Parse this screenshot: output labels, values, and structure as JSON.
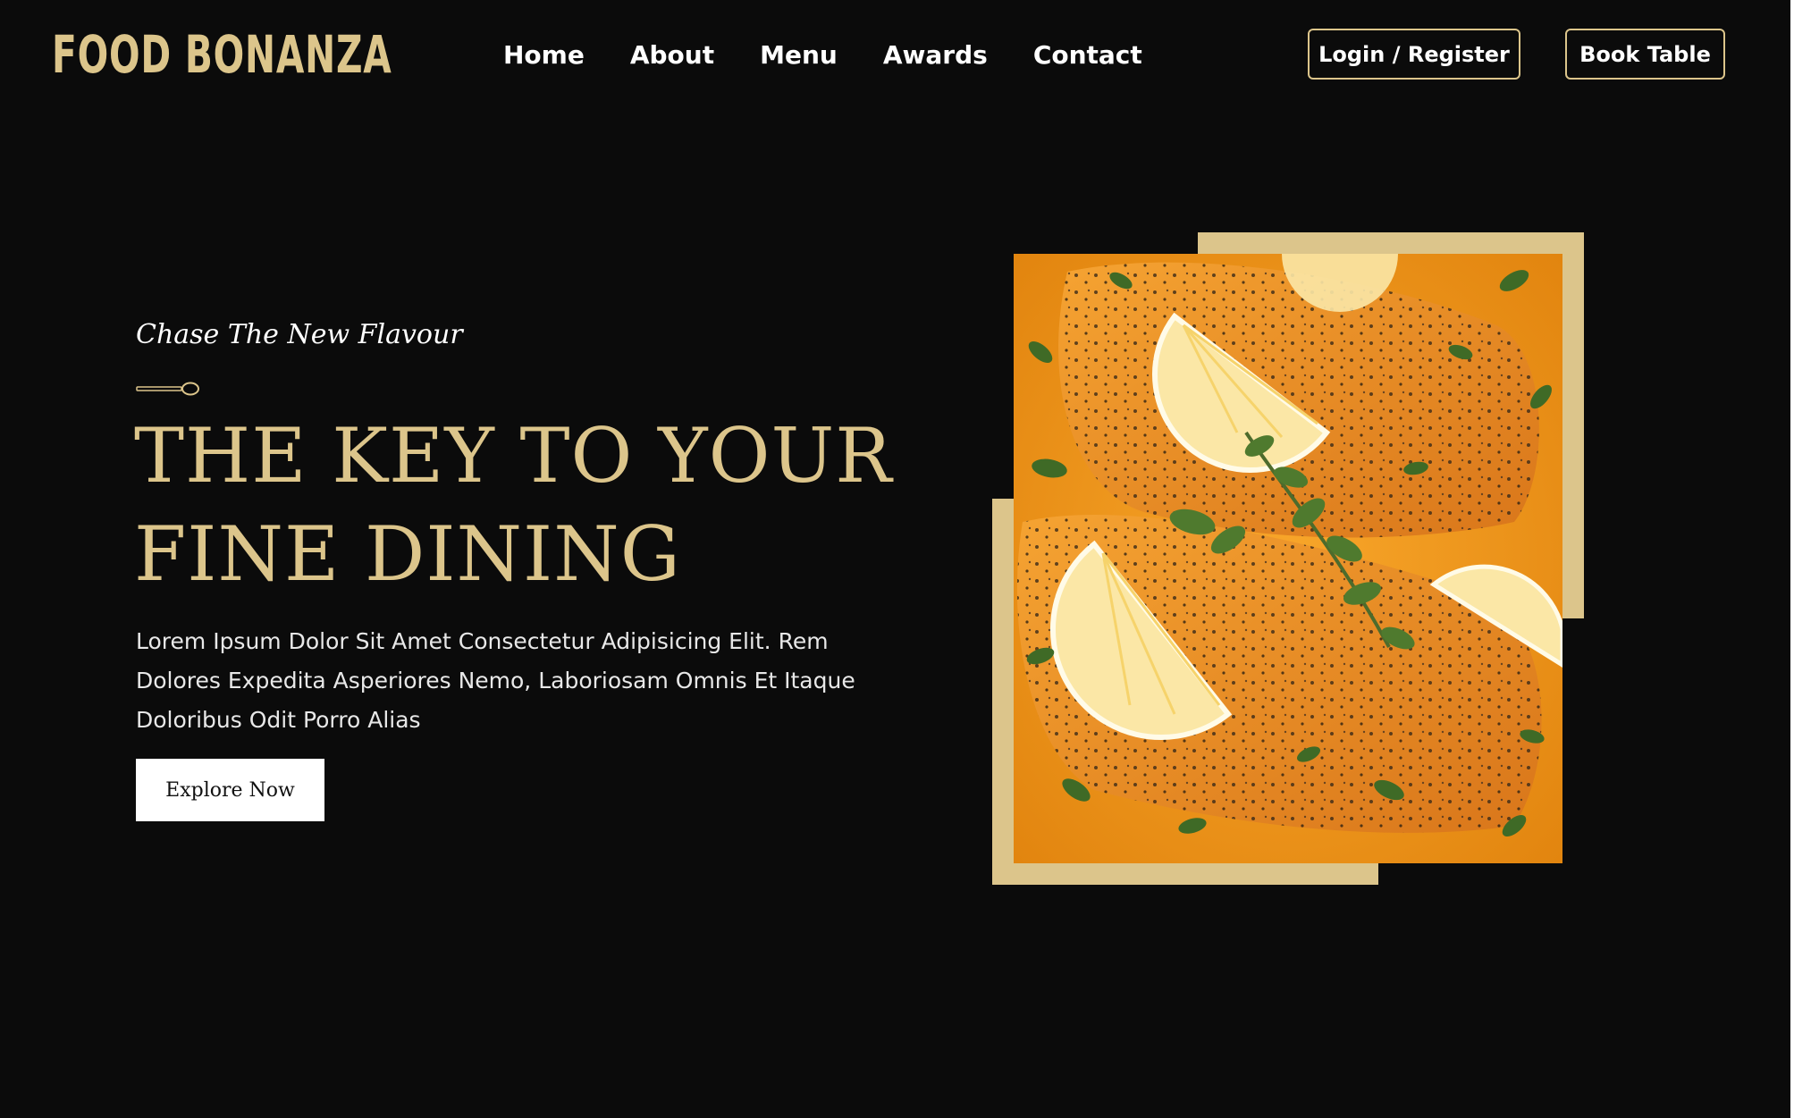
{
  "brand": {
    "logo_text": "FOOD BONANZA",
    "accent_color": "#dcc58b",
    "background_color": "#0b0b0b"
  },
  "nav": {
    "items": [
      "Home",
      "About",
      "Menu",
      "Awards",
      "Contact"
    ]
  },
  "header_buttons": {
    "login_label": "Login / Register",
    "book_label": "Book Table"
  },
  "hero": {
    "tagline": "Chase The New Flavour",
    "divider_icon": "spoon-icon",
    "headline_line1": "THE KEY TO YOUR",
    "headline_line2": "FINE DINING",
    "description_line1": "Lorem Ipsum Dolor Sit Amet Consectetur Adipisicing Elit. Rem",
    "description_line2": "Dolores Expedita Asperiores Nemo, Laboriosam Omnis Et Itaque",
    "description_line3": "Doloribus Odit Porro Alias",
    "cta_label": "Explore Now"
  }
}
